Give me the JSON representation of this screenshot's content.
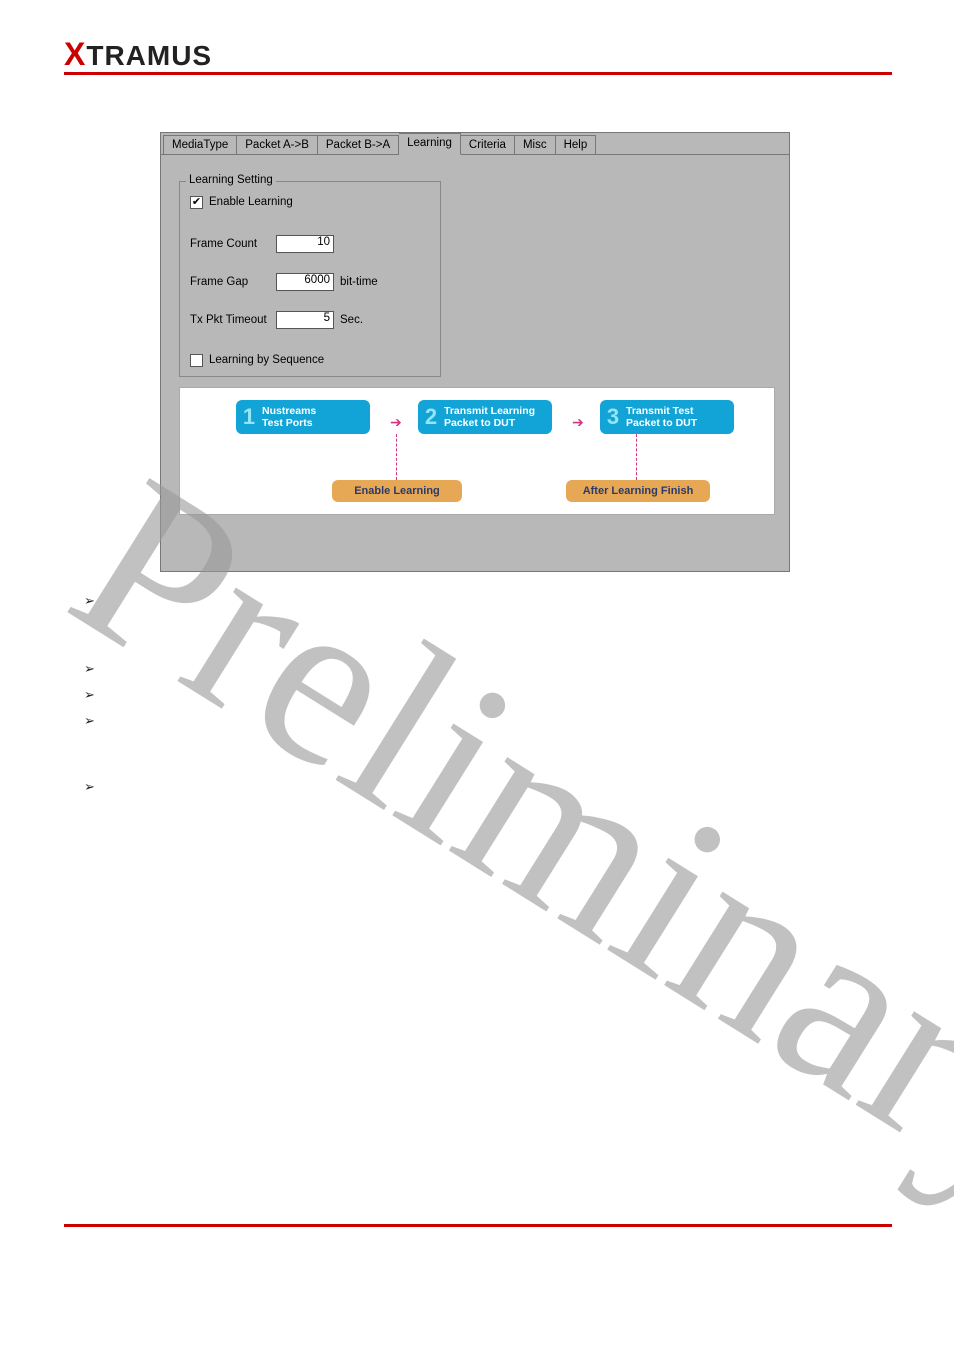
{
  "logo": {
    "x": "X",
    "rest": "TRAMUS"
  },
  "tabs": [
    "MediaType",
    "Packet A->B",
    "Packet B->A",
    "Learning",
    "Criteria",
    "Misc",
    "Help"
  ],
  "active_tab_index": 3,
  "group": {
    "title": "Learning Setting",
    "enable_label": "Enable Learning",
    "enable_checked": "✔",
    "frame_count_label": "Frame Count",
    "frame_count_value": "10",
    "frame_gap_label": "Frame Gap",
    "frame_gap_value": "6000",
    "frame_gap_unit": "bit-time",
    "tx_label": "Tx Pkt Timeout",
    "tx_value": "5",
    "tx_unit": "Sec.",
    "seq_label": "Learning by Sequence",
    "seq_checked": ""
  },
  "diagram": {
    "b1_num": "1",
    "b1_txt": "Nustreams\nTest Ports",
    "b2_num": "2",
    "b2_txt": "Transmit Learning\nPacket to DUT",
    "b3_num": "3",
    "b3_txt": "Transmit Test\nPacket to DUT",
    "o1": "Enable Learning",
    "o2": "After Learning Finish"
  },
  "bullets": [
    "➢",
    "➢",
    "➢",
    "➢",
    "➢"
  ],
  "watermark": "Preliminary"
}
